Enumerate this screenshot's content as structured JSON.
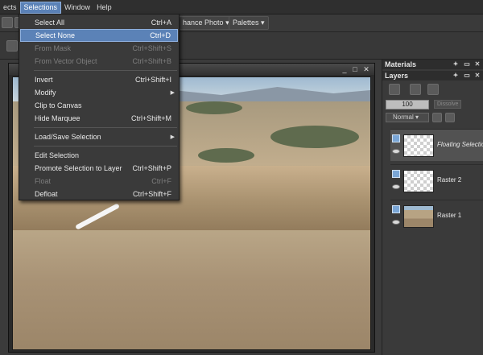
{
  "menubar": {
    "items": [
      {
        "label": "ects"
      },
      {
        "label": "Selections",
        "active": true
      },
      {
        "label": "Window"
      },
      {
        "label": "Help"
      }
    ]
  },
  "toolbar": {
    "enhance_photo": "hance Photo",
    "palettes": "Palettes",
    "dropdown_glyph": "▾"
  },
  "selections_menu": {
    "items": [
      {
        "label": "Select All",
        "shortcut": "Ctrl+A",
        "disabled": false
      },
      {
        "label": "Select None",
        "shortcut": "Ctrl+D",
        "disabled": false,
        "highlighted": true
      },
      {
        "label": "From Mask",
        "shortcut": "Ctrl+Shift+S",
        "disabled": true
      },
      {
        "label": "From Vector Object",
        "shortcut": "Ctrl+Shift+B",
        "disabled": true
      },
      {
        "label": "Invert",
        "shortcut": "Ctrl+Shift+I",
        "disabled": false
      },
      {
        "label": "Modify",
        "shortcut": "",
        "disabled": false,
        "submenu": true
      },
      {
        "label": "Clip to Canvas",
        "shortcut": "",
        "disabled": false
      },
      {
        "label": "Hide Marquee",
        "shortcut": "Ctrl+Shift+M",
        "disabled": false
      },
      {
        "label": "Load/Save Selection",
        "shortcut": "",
        "disabled": false,
        "submenu": true
      },
      {
        "label": "Edit Selection",
        "shortcut": "",
        "disabled": false
      },
      {
        "label": "Promote Selection to Layer",
        "shortcut": "Ctrl+Shift+P",
        "disabled": false
      },
      {
        "label": "Float",
        "shortcut": "Ctrl+F",
        "disabled": true
      },
      {
        "label": "Defloat",
        "shortcut": "Ctrl+Shift+F",
        "disabled": false
      }
    ],
    "submenu_glyph": "▶"
  },
  "document": {
    "controls": [
      "_",
      "□",
      "✕"
    ]
  },
  "materials_panel": {
    "title": "Materials",
    "controls": [
      "✦",
      "▭",
      "✕"
    ]
  },
  "layers_panel": {
    "title": "Layers",
    "controls": [
      "✦",
      "▭",
      "✕"
    ],
    "opacity": "100",
    "blend_mode": "Normal",
    "blend_glyph": "▾",
    "dim_label": "Dissolve",
    "layers": [
      {
        "name": "Floating Selection",
        "italic": true,
        "selected": true
      },
      {
        "name": "Raster 2",
        "italic": false,
        "selected": false
      },
      {
        "name": "Raster 1",
        "italic": false,
        "selected": false
      }
    ]
  },
  "colors": {
    "highlight": "#5b82b7",
    "background": "#3d3d3d"
  }
}
